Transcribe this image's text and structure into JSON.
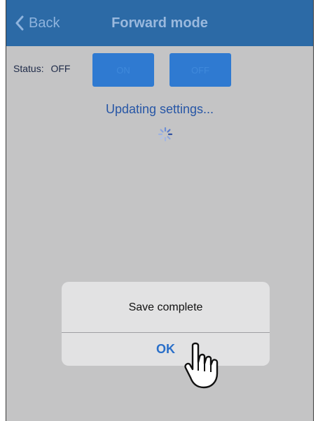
{
  "navbar": {
    "back_label": "Back",
    "title": "Forward mode",
    "back_icon": "chevron-left-icon",
    "background": "#2c6aa6"
  },
  "status": {
    "label": "Status:",
    "value": "OFF"
  },
  "buttons": {
    "on_label": "ON",
    "off_label": "OFF",
    "color": "#2f7ad1"
  },
  "progress": {
    "message": "Updating settings...",
    "icon": "spinner-icon"
  },
  "alert": {
    "message": "Save complete",
    "ok_label": "OK"
  },
  "cursor": {
    "icon": "pointing-hand-icon"
  },
  "colors": {
    "overlay_background": "#c4c4c5",
    "accent": "#2a6fc9"
  }
}
